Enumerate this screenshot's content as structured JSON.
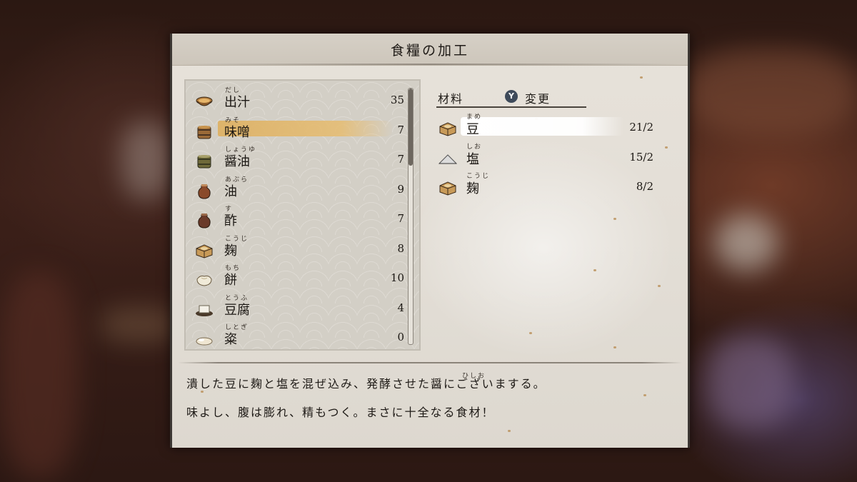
{
  "window_title": "食糧の加工",
  "food_list": [
    {
      "ruby": "だし",
      "name": "出汁",
      "count": "35",
      "icon": "bowl-icon"
    },
    {
      "ruby": "みそ",
      "name": "味噌",
      "count": "7",
      "icon": "miso-barrel-icon"
    },
    {
      "ruby": "しょうゆ",
      "name": "醤油",
      "count": "7",
      "icon": "soy-sauce-barrel-icon"
    },
    {
      "ruby": "あぶら",
      "name": "油",
      "count": "9",
      "icon": "oil-jar-icon"
    },
    {
      "ruby": "す",
      "name": "酢",
      "count": "7",
      "icon": "vinegar-jar-icon"
    },
    {
      "ruby": "こうじ",
      "name": "麹",
      "count": "8",
      "icon": "koji-box-icon"
    },
    {
      "ruby": "もち",
      "name": "餅",
      "count": "10",
      "icon": "mochi-icon"
    },
    {
      "ruby": "とうふ",
      "name": "豆腐",
      "count": "4",
      "icon": "tofu-icon"
    },
    {
      "ruby": "しとぎ",
      "name": "粢",
      "count": "0",
      "icon": "shitogi-icon"
    }
  ],
  "selected_food_index": 1,
  "materials_header": {
    "label": "材料",
    "button_glyph": "Y",
    "action_label": "変更"
  },
  "materials": [
    {
      "ruby": "まめ",
      "name": "豆",
      "qty": "21/2",
      "icon": "bean-box-icon"
    },
    {
      "ruby": "しお",
      "name": "塩",
      "qty": "15/2",
      "icon": "salt-pile-icon"
    },
    {
      "ruby": "こうじ",
      "name": "麹",
      "qty": "8/2",
      "icon": "koji-box-icon"
    }
  ],
  "description": {
    "line1": "潰した豆に麹と塩を混ぜ込み、発酵させた醤にございまする。",
    "line1_ruby": "ひしお",
    "line2": "味よし、腹は膨れ、精もつく。まさに十全なる食材！"
  },
  "colors": {
    "panel_bg": "#e4dfd7",
    "highlight": "#e2b46a",
    "text": "#1b1713"
  }
}
